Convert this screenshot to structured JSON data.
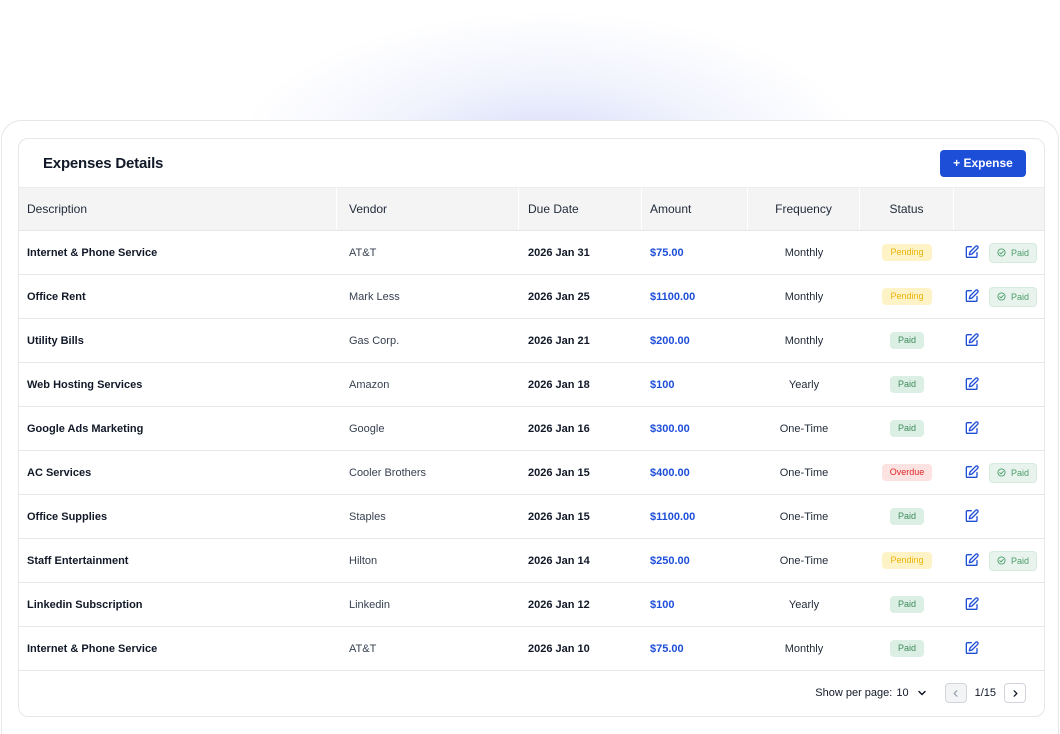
{
  "header": {
    "title": "Expenses Details",
    "add_button": "+ Expense"
  },
  "columns": {
    "description": "Description",
    "vendor": "Vendor",
    "due_date": "Due Date",
    "amount": "Amount",
    "frequency": "Frequency",
    "status": "Status"
  },
  "rows": [
    {
      "description": "Internet & Phone Service",
      "vendor": "AT&T",
      "due_date": "2026 Jan 31",
      "amount": "$75.00",
      "frequency": "Monthly",
      "status": "Pending",
      "mark_paid": "Paid"
    },
    {
      "description": "Office Rent",
      "vendor": "Mark Less",
      "due_date": "2026 Jan 25",
      "amount": "$1100.00",
      "frequency": "Monthly",
      "status": "Pending",
      "mark_paid": "Paid"
    },
    {
      "description": "Utility Bills",
      "vendor": "Gas Corp.",
      "due_date": "2026 Jan 21",
      "amount": "$200.00",
      "frequency": "Monthly",
      "status": "Paid"
    },
    {
      "description": "Web Hosting Services",
      "vendor": "Amazon",
      "due_date": "2026 Jan 18",
      "amount": "$100",
      "frequency": "Yearly",
      "status": "Paid"
    },
    {
      "description": "Google Ads Marketing",
      "vendor": "Google",
      "due_date": "2026 Jan 16",
      "amount": "$300.00",
      "frequency": "One-Time",
      "status": "Paid"
    },
    {
      "description": "AC Services",
      "vendor": "Cooler Brothers",
      "due_date": "2026 Jan 15",
      "amount": "$400.00",
      "frequency": "One-Time",
      "status": "Overdue",
      "mark_paid": "Paid"
    },
    {
      "description": "Office Supplies",
      "vendor": "Staples",
      "due_date": "2026 Jan 15",
      "amount": "$1100.00",
      "frequency": "One-Time",
      "status": "Paid"
    },
    {
      "description": "Staff Entertainment",
      "vendor": "Hilton",
      "due_date": "2026 Jan 14",
      "amount": "$250.00",
      "frequency": "One-Time",
      "status": "Pending",
      "mark_paid": "Paid"
    },
    {
      "description": "Linkedin Subscription",
      "vendor": "Linkedin",
      "due_date": "2026 Jan 12",
      "amount": "$100",
      "frequency": "Yearly",
      "status": "Paid"
    },
    {
      "description": "Internet & Phone Service",
      "vendor": "AT&T",
      "due_date": "2026 Jan 10",
      "amount": "$75.00",
      "frequency": "Monthly",
      "status": "Paid"
    }
  ],
  "footer": {
    "per_page_label": "Show per page:",
    "per_page_value": "10",
    "page_indicator": "1/15"
  },
  "colors": {
    "accent": "#1d4ed8",
    "pending": "#eab308",
    "paid": "#3f8a5c",
    "overdue": "#dc2626"
  },
  "icons": {
    "edit": "edit-icon",
    "mark_paid": "check-circle-icon",
    "per_page_dropdown": "chevron-down-icon",
    "prev": "chevron-left-icon",
    "next": "chevron-right-icon"
  }
}
